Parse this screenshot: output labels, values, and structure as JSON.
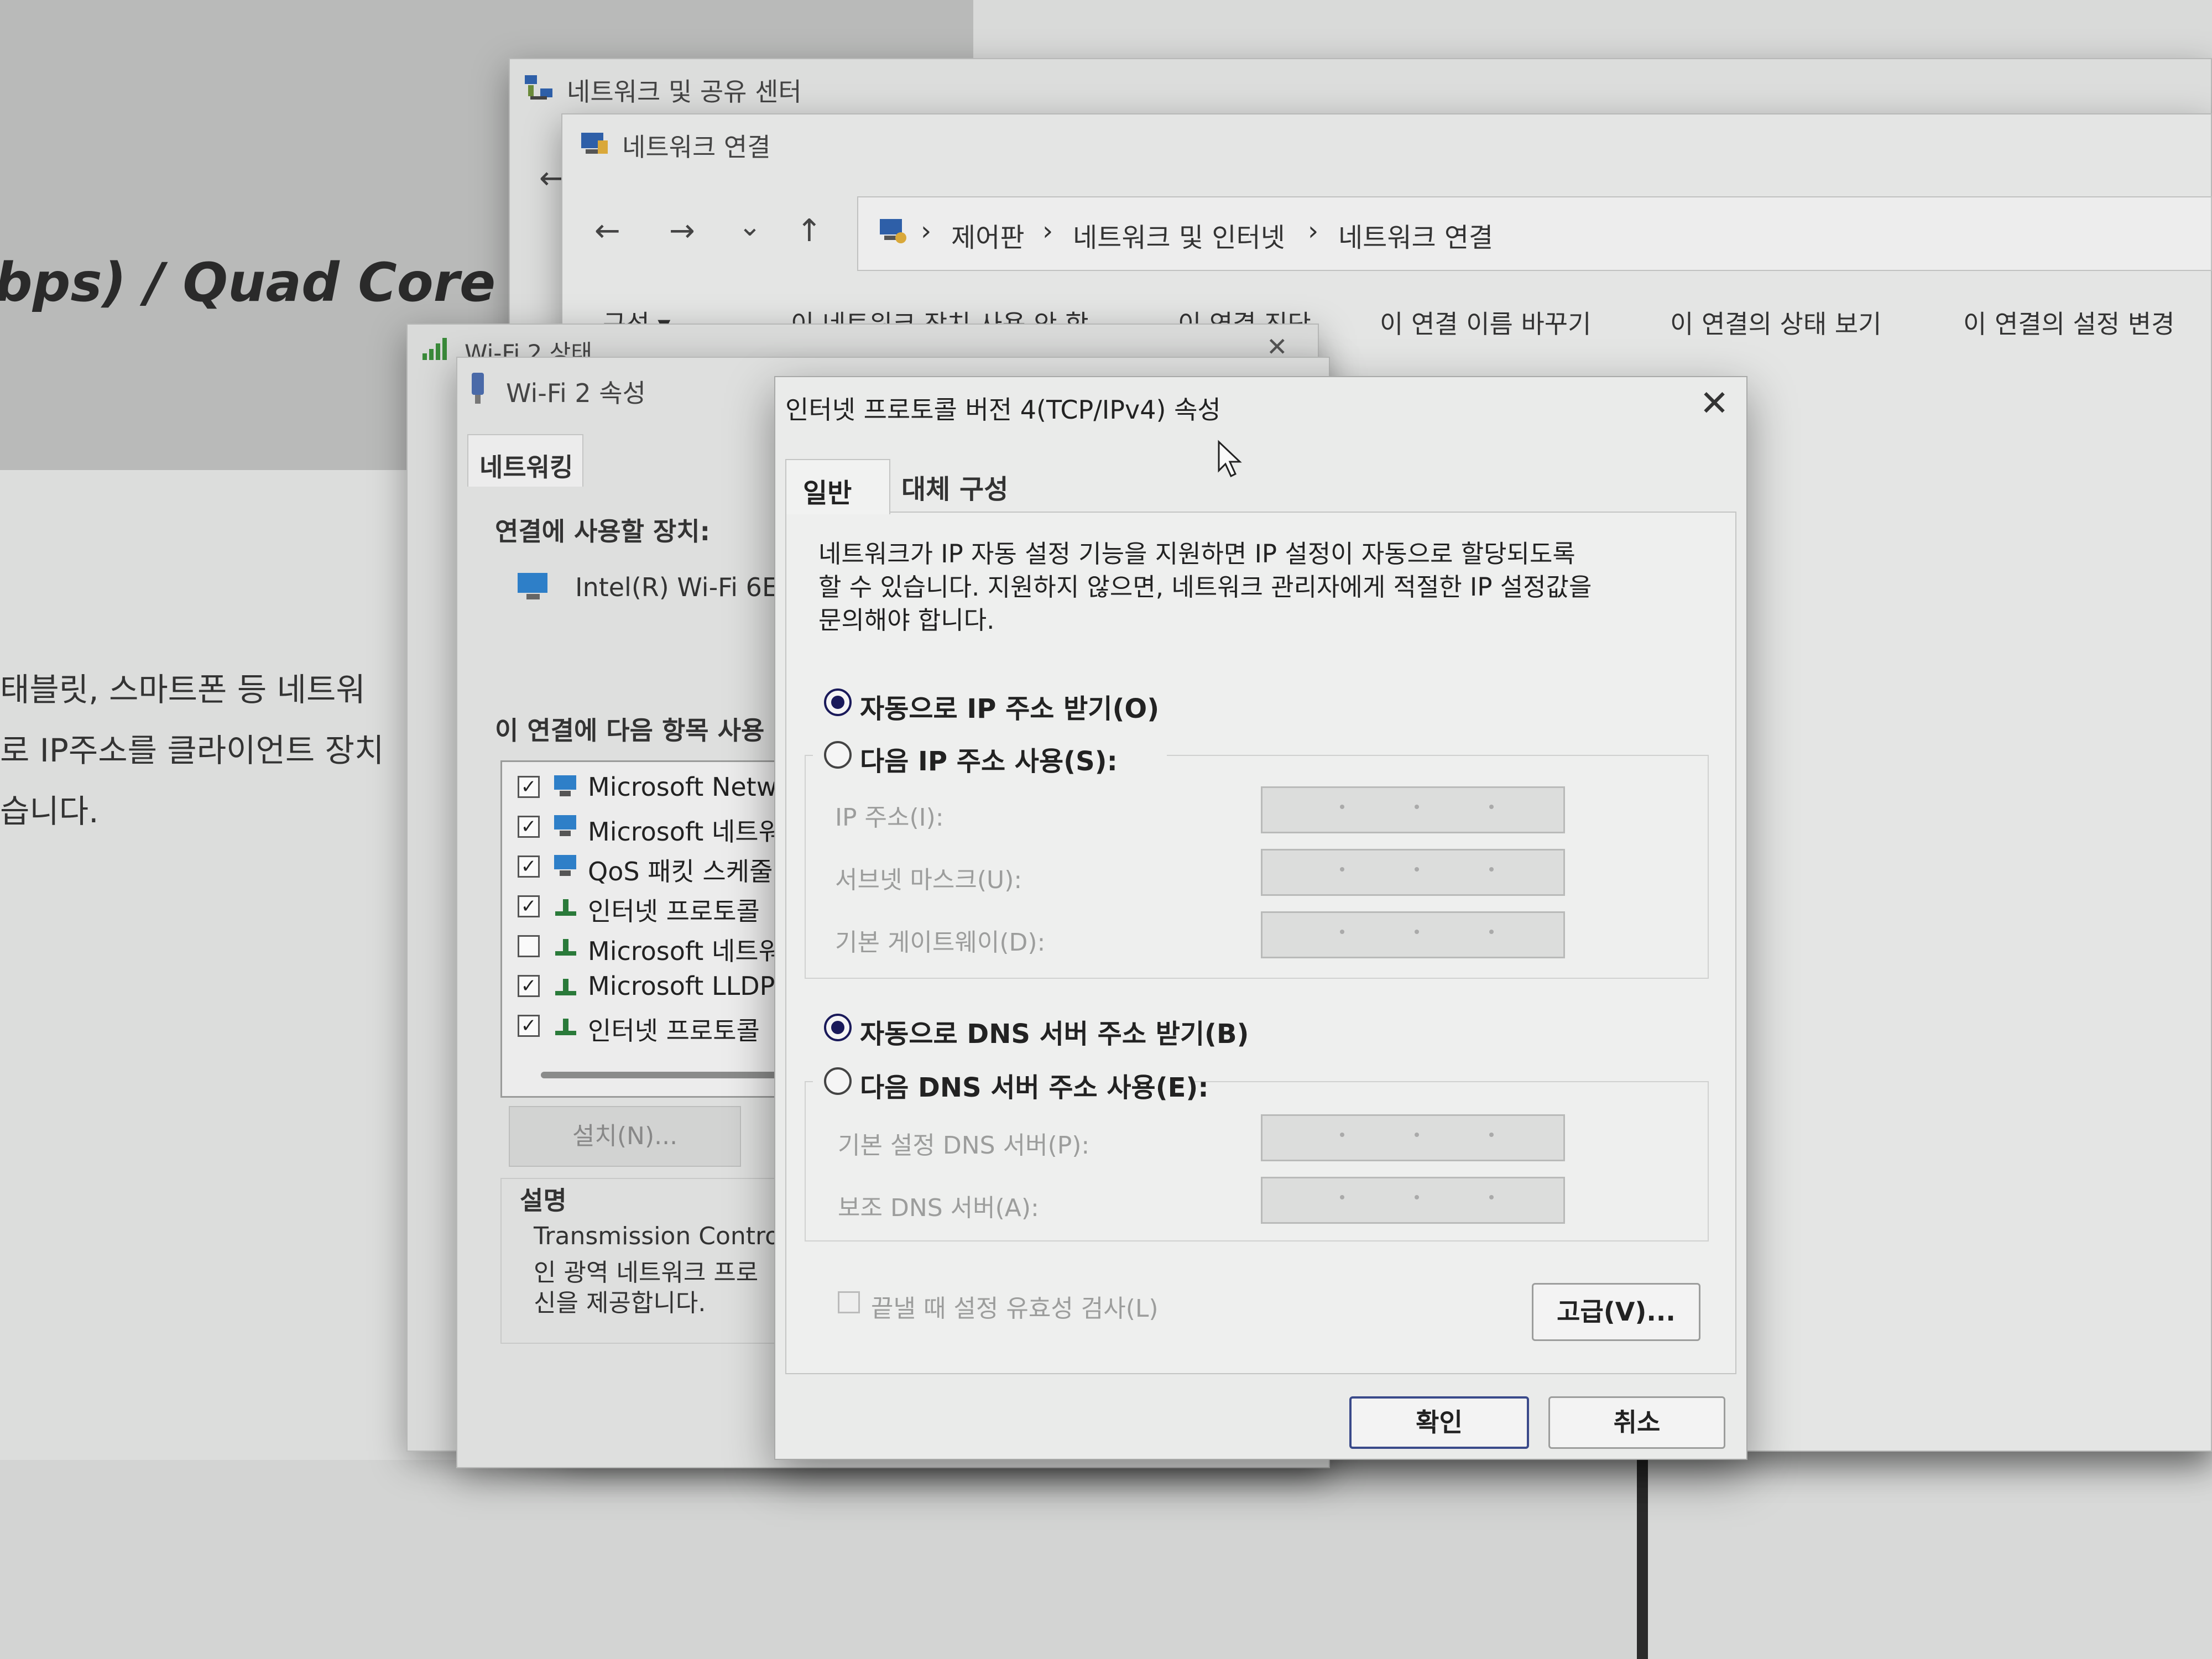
{
  "background_page": {
    "headline": "bps) / Quad Core",
    "lines": [
      "태블릿, 스마트폰 등 네트워",
      "로 IP주소를 클라이언트 장치",
      "습니다."
    ]
  },
  "network_sharing_center": {
    "title": "네트워크 및 공유 센터"
  },
  "network_connections": {
    "title": "네트워크 연결",
    "nav": {
      "back": "←",
      "forward": "→",
      "recent": "⌄",
      "up": "↑"
    },
    "breadcrumb": [
      "제어판",
      "네트워크 및 인터넷",
      "네트워크 연결"
    ],
    "breadcrumb_sep": "›",
    "commands": [
      "구성 ▾",
      "이 네트워크 장치 사용 안 함",
      "이 연결 진단",
      "이 연결 이름 바꾸기",
      "이 연결의 상태 보기",
      "이 연결의 설정 변경"
    ]
  },
  "wifi_status": {
    "title": "Wi-Fi 2 상태",
    "close": "✕"
  },
  "wifi_properties": {
    "title": "Wi-Fi 2 속성",
    "tab": "네트워킹",
    "device_label": "연결에 사용할 장치:",
    "device_name": "Intel(R) Wi-Fi 6E",
    "items_label": "이 연결에 다음 항목 사용",
    "components": [
      {
        "checked": true,
        "label": "Microsoft Netwo"
      },
      {
        "checked": true,
        "label": "Microsoft 네트워"
      },
      {
        "checked": true,
        "label": "QoS 패킷 스케줄"
      },
      {
        "checked": true,
        "label": "인터넷 프로토콜"
      },
      {
        "checked": false,
        "label": "Microsoft 네트워"
      },
      {
        "checked": true,
        "label": "Microsoft LLDP"
      },
      {
        "checked": true,
        "label": "인터넷 프로토콜"
      }
    ],
    "install_button": "설치(N)...",
    "description_label": "설명",
    "description_lines": [
      "Transmission Control",
      "인 광역 네트워크 프로",
      "신을 제공합니다."
    ]
  },
  "ipv4_dialog": {
    "title": "인터넷 프로토콜 버전 4(TCP/IPv4) 속성",
    "close": "✕",
    "tabs": [
      "일반",
      "대체 구성"
    ],
    "description_lines": [
      "네트워크가 IP 자동 설정 기능을 지원하면 IP 설정이 자동으로 할당되도록",
      "할 수 있습니다. 지원하지 않으면, 네트워크 관리자에게 적절한 IP 설정값을",
      "문의해야 합니다."
    ],
    "ip_auto": {
      "label": "자동으로 IP 주소 받기(O)",
      "selected": true
    },
    "ip_manual": {
      "label": "다음 IP 주소 사용(S):",
      "selected": false
    },
    "ip_fields": [
      "IP 주소(I):",
      "서브넷 마스크(U):",
      "기본 게이트웨이(D):"
    ],
    "dns_auto": {
      "label": "자동으로 DNS 서버 주소 받기(B)",
      "selected": true
    },
    "dns_manual": {
      "label": "다음 DNS 서버 주소 사용(E):",
      "selected": false
    },
    "dns_fields": [
      "기본 설정 DNS 서버(P):",
      "보조 DNS 서버(A):"
    ],
    "validate": {
      "label": "끝낼 때 설정 유효성 검사(L)",
      "checked": false
    },
    "advanced_button": "고급(V)...",
    "ok_button": "확인",
    "cancel_button": "취소"
  }
}
